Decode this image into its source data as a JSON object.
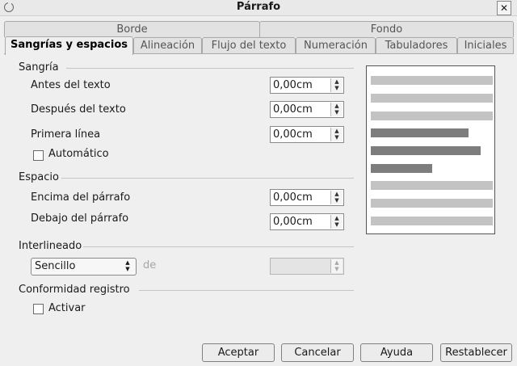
{
  "window": {
    "title": "Párrafo",
    "close_symbol": "✕"
  },
  "tabs_row1": [
    {
      "label": "Borde"
    },
    {
      "label": "Fondo"
    }
  ],
  "tabs_row2": [
    {
      "label": "Sangrías y espacios"
    },
    {
      "label": "Alineación"
    },
    {
      "label": "Flujo del texto"
    },
    {
      "label": "Numeración"
    },
    {
      "label": "Tabuladores"
    },
    {
      "label": "Iniciales"
    }
  ],
  "indent": {
    "heading": "Sangría",
    "before": {
      "label": "Antes del texto",
      "value": "0,00cm"
    },
    "after": {
      "label": "Después del texto",
      "value": "0,00cm"
    },
    "first": {
      "label": "Primera línea",
      "value": "0,00cm"
    },
    "auto": {
      "label": "Automático",
      "checked": false
    }
  },
  "spacing": {
    "heading": "Espacio",
    "above": {
      "label": "Encima del párrafo",
      "value": "0,00cm"
    },
    "below": {
      "label": "Debajo del párrafo",
      "value": "0,00cm"
    }
  },
  "line_spacing": {
    "heading": "Interlineado",
    "selected": "Sencillo",
    "of_label": "de",
    "value": ""
  },
  "register": {
    "heading": "Conformidad registro",
    "activate": {
      "label": "Activar",
      "checked": false
    }
  },
  "buttons": {
    "ok": "Aceptar",
    "cancel": "Cancelar",
    "help": "Ayuda",
    "reset": "Restablecer"
  },
  "colors": {
    "preview_light": "#c3c3c3",
    "preview_dark": "#7d7d7d"
  }
}
